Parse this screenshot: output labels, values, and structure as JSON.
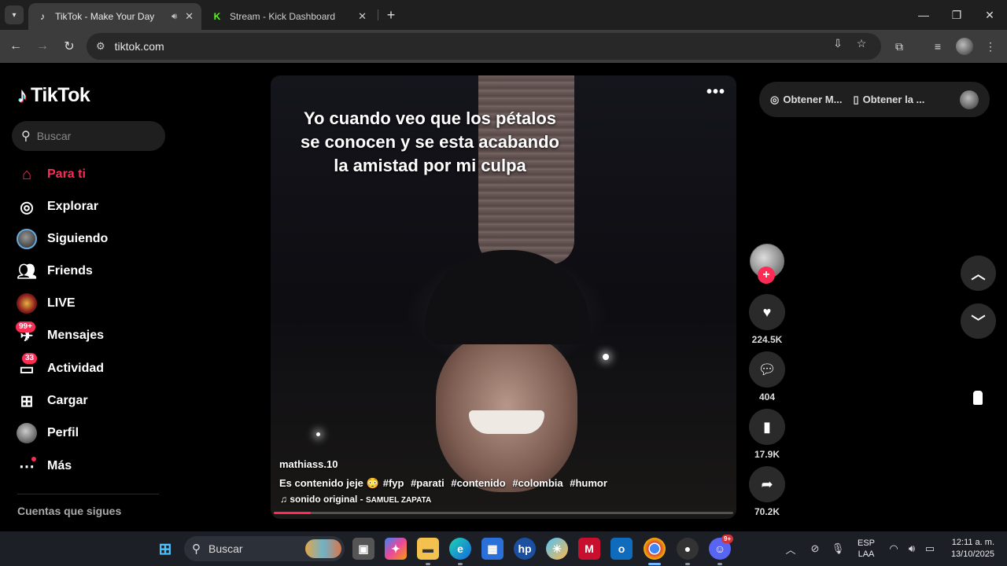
{
  "browser": {
    "tabs": [
      {
        "title": "TikTok - Make Your Day",
        "active": true,
        "audio": true
      },
      {
        "title": "Stream - Kick Dashboard",
        "active": false,
        "audio": false
      }
    ],
    "url": "tiktok.com"
  },
  "tiktok": {
    "logo_text": "TikTok",
    "search_placeholder": "Buscar",
    "nav": [
      {
        "label": "Para ti",
        "icon": "home-icon",
        "active": true
      },
      {
        "label": "Explorar",
        "icon": "compass-icon"
      },
      {
        "label": "Siguiendo",
        "icon": "avatar-icon"
      },
      {
        "label": "Friends",
        "icon": "friends-icon"
      },
      {
        "label": "LIVE",
        "icon": "live-icon"
      },
      {
        "label": "Mensajes",
        "icon": "messages-icon",
        "badge": "99+"
      },
      {
        "label": "Actividad",
        "icon": "activity-icon",
        "badge": "33"
      },
      {
        "label": "Cargar",
        "icon": "upload-icon"
      },
      {
        "label": "Perfil",
        "icon": "profile-avatar-icon"
      },
      {
        "label": "Más",
        "icon": "more-icon",
        "dot": true
      }
    ],
    "following_title": "Cuentas que sigues",
    "video": {
      "caption_text": "Yo cuando veo que los pétalos se conocen y se esta acabando la amistad por mi culpa",
      "author": "mathiass.10",
      "description": "Es contenido jeje 😳",
      "hashtags": [
        "#fyp",
        "#parati",
        "#contenido",
        "#colombia",
        "#humor"
      ],
      "music": "sonido original - ",
      "music_artist": "SAMUEL ZAPATA",
      "progress": 0.08
    },
    "actions": {
      "likes": "224.5K",
      "comments": "404",
      "saves": "17.9K",
      "shares": "70.2K"
    },
    "top_pill": {
      "item1": "Obtener M...",
      "item2": "Obtener la ..."
    }
  },
  "taskbar": {
    "search_placeholder": "Buscar",
    "discord_badge": "9+",
    "lang_line1": "ESP",
    "lang_line2": "LAA",
    "time": "12:11 a. m.",
    "date": "13/10/2025"
  },
  "colors": {
    "accent": "#fe2c55",
    "background": "#000000"
  }
}
